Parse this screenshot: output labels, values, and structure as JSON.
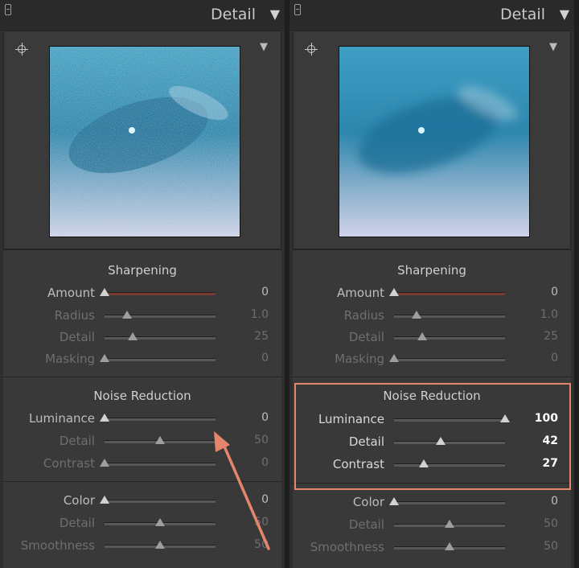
{
  "left": {
    "header": {
      "title": "Detail"
    },
    "sharpening": {
      "title": "Sharpening",
      "rows": [
        {
          "label": "Amount",
          "value": "0",
          "fraction": 0.0
        },
        {
          "label": "Radius",
          "value": "1.0",
          "fraction": 0.2
        },
        {
          "label": "Detail",
          "value": "25",
          "fraction": 0.25
        },
        {
          "label": "Masking",
          "value": "0",
          "fraction": 0.0
        }
      ]
    },
    "noise_luminance": {
      "title": "Noise Reduction",
      "rows": [
        {
          "label": "Luminance",
          "value": "0",
          "fraction": 0.0
        },
        {
          "label": "Detail",
          "value": "50",
          "fraction": 0.5
        },
        {
          "label": "Contrast",
          "value": "0",
          "fraction": 0.0
        }
      ]
    },
    "noise_color": {
      "rows": [
        {
          "label": "Color",
          "value": "0",
          "fraction": 0.0
        },
        {
          "label": "Detail",
          "value": "50",
          "fraction": 0.5
        },
        {
          "label": "Smoothness",
          "value": "50",
          "fraction": 0.5
        }
      ]
    }
  },
  "right": {
    "header": {
      "title": "Detail"
    },
    "sharpening": {
      "title": "Sharpening",
      "rows": [
        {
          "label": "Amount",
          "value": "0",
          "fraction": 0.0
        },
        {
          "label": "Radius",
          "value": "1.0",
          "fraction": 0.2
        },
        {
          "label": "Detail",
          "value": "25",
          "fraction": 0.25
        },
        {
          "label": "Masking",
          "value": "0",
          "fraction": 0.0
        }
      ]
    },
    "noise_luminance": {
      "title": "Noise Reduction",
      "rows": [
        {
          "label": "Luminance",
          "value": "100",
          "fraction": 1.0
        },
        {
          "label": "Detail",
          "value": "42",
          "fraction": 0.42
        },
        {
          "label": "Contrast",
          "value": "27",
          "fraction": 0.27
        }
      ]
    },
    "noise_color": {
      "rows": [
        {
          "label": "Color",
          "value": "0",
          "fraction": 0.0
        },
        {
          "label": "Detail",
          "value": "50",
          "fraction": 0.5
        },
        {
          "label": "Smoothness",
          "value": "50",
          "fraction": 0.5
        }
      ]
    }
  },
  "colors": {
    "panel": "#2f2f2f",
    "section": "#393939",
    "highlight": "#e5866c",
    "preview_blue": "#2a8bb0"
  },
  "icons": [
    "panel-grip-icon",
    "collapse-triangle-icon",
    "target-crosshair-icon",
    "preview-menu-icon",
    "annotation-arrow-icon"
  ]
}
